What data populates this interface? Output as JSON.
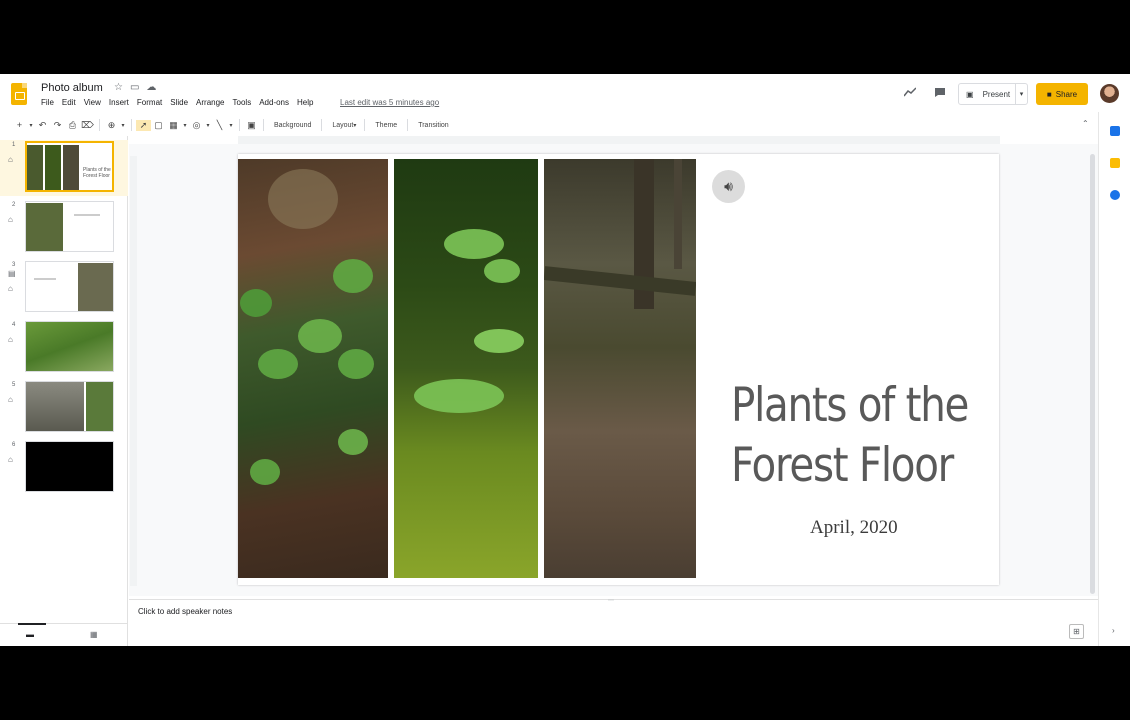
{
  "header": {
    "doc_title": "Photo album",
    "star_icon": "☆",
    "folder_icon": "▭",
    "cloud_icon": "☁",
    "menu": [
      "File",
      "Edit",
      "View",
      "Insert",
      "Format",
      "Slide",
      "Arrange",
      "Tools",
      "Add-ons",
      "Help"
    ],
    "last_edit": "Last edit was 5 minutes ago",
    "present_label": "Present",
    "share_label": "Share"
  },
  "toolbar": {
    "background_label": "Background",
    "layout_label": "Layout",
    "theme_label": "Theme",
    "transition_label": "Transition"
  },
  "filmstrip": {
    "slides": [
      {
        "num": "1",
        "thumb_title": "Plants of the Forest Floor"
      },
      {
        "num": "2"
      },
      {
        "num": "3"
      },
      {
        "num": "4"
      },
      {
        "num": "5"
      },
      {
        "num": "6"
      }
    ]
  },
  "slide": {
    "title_line1": "Plants of the",
    "title_line2": "Forest Floor",
    "subtitle": "April, 2020"
  },
  "notes": {
    "placeholder": "Click to add speaker notes"
  },
  "colors": {
    "accent": "#f4b400",
    "title_text": "#595959"
  }
}
